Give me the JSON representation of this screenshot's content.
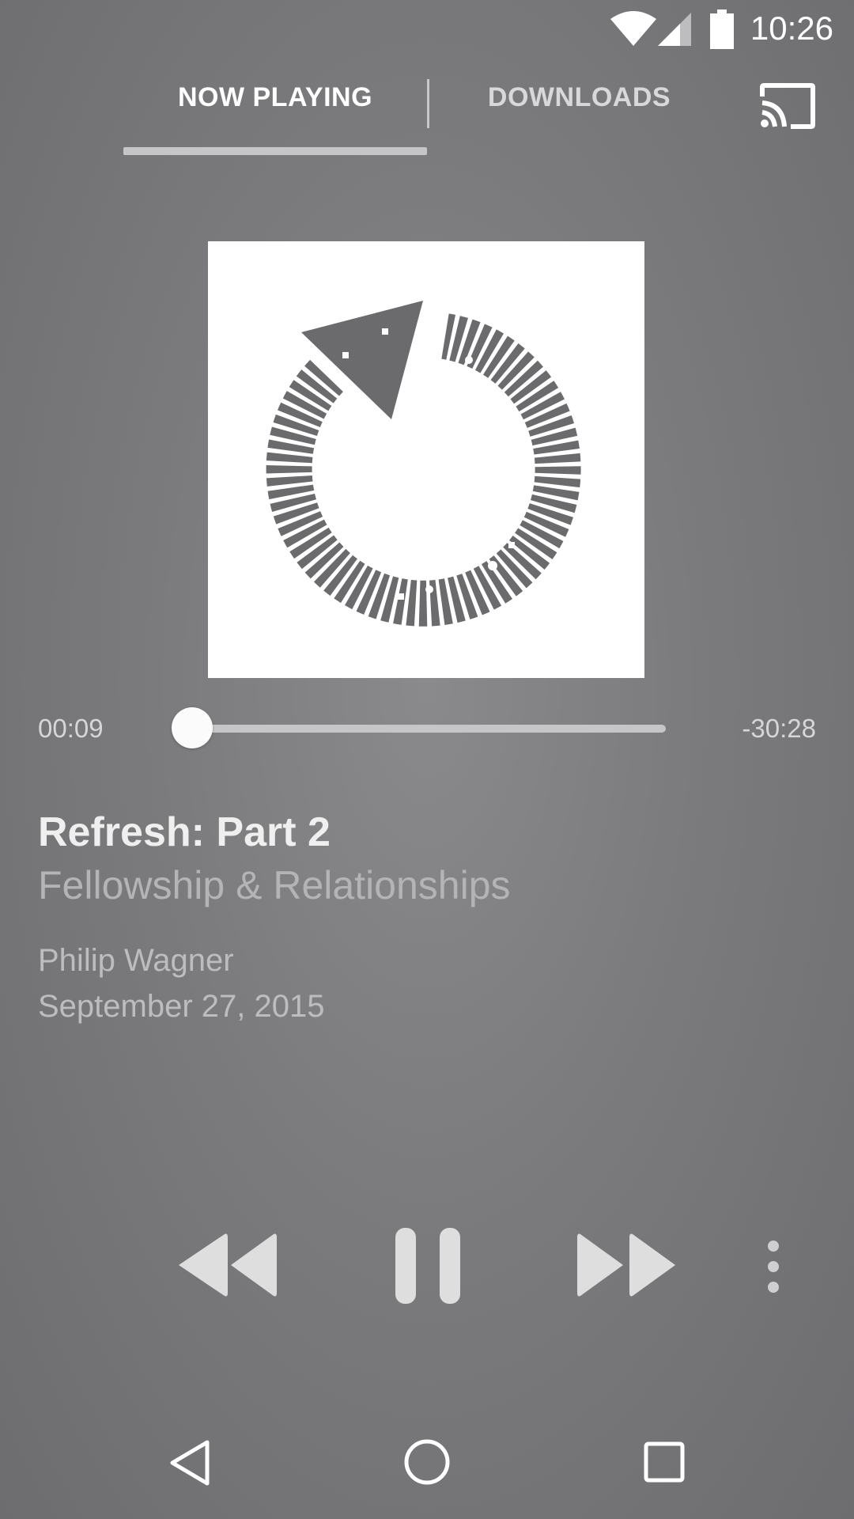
{
  "status_bar": {
    "time": "10:26",
    "icons": [
      "wifi-icon",
      "signal-icon",
      "battery-icon"
    ]
  },
  "tabs": [
    {
      "label": "NOW PLAYING",
      "selected": true
    },
    {
      "label": "DOWNLOADS",
      "selected": false
    }
  ],
  "toolbar": {
    "cast_icon": "cast-icon"
  },
  "artwork": {
    "icon": "refresh-arrow-icon"
  },
  "player": {
    "elapsed": "00:09",
    "remaining": "-30:28",
    "progress_fraction": 0.005
  },
  "track": {
    "title": "Refresh: Part 2",
    "series": "Fellowship & Relationships",
    "speaker": "Philip Wagner",
    "date": "September 27, 2015"
  },
  "controls": [
    "rewind-icon",
    "pause-icon",
    "fast-forward-icon",
    "more-vert-icon"
  ],
  "nav": [
    "back-icon",
    "home-icon",
    "recents-icon"
  ],
  "colors": {
    "background": "#7b7b7d",
    "artwork_icon": "#666668",
    "control": "#dededf"
  }
}
